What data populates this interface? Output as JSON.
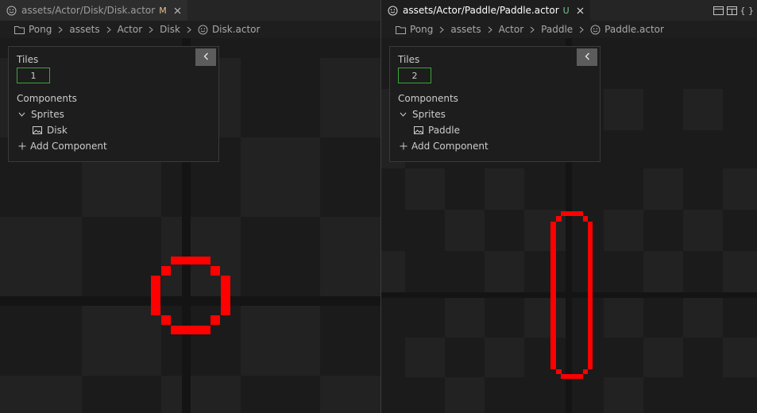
{
  "panes": [
    {
      "tab": {
        "title": "assets/Actor/Disk/Disk.actor",
        "status": "M",
        "status_color": "#e2c08d"
      },
      "breadcrumb": [
        "Pong",
        "assets",
        "Actor",
        "Disk",
        "Disk.actor"
      ],
      "panel": {
        "tiles_label": "Tiles",
        "tiles_value": "1",
        "components_label": "Components",
        "group_label": "Sprites",
        "sprite_name": "Disk",
        "add_component_label": "Add Component"
      },
      "sprite_shape": "circle",
      "sprite_color": "#ff0000"
    },
    {
      "tab": {
        "title": "assets/Actor/Paddle/Paddle.actor",
        "status": "U",
        "status_color": "#73c991"
      },
      "breadcrumb": [
        "Pong",
        "assets",
        "Actor",
        "Paddle",
        "Paddle.actor"
      ],
      "panel": {
        "tiles_label": "Tiles",
        "tiles_value": "2",
        "components_label": "Components",
        "group_label": "Sprites",
        "sprite_name": "Paddle",
        "add_component_label": "Add Component"
      },
      "sprite_shape": "rounded-rectangle",
      "sprite_color": "#ff0000"
    }
  ],
  "editor_actions": {
    "json_label": "{ }",
    "icons": [
      "split-editor-icon",
      "preview-icon"
    ]
  },
  "colors": {
    "checker_dark": "#1b1b1b",
    "checker_light": "#232323",
    "accent_green": "#3aa53a"
  }
}
